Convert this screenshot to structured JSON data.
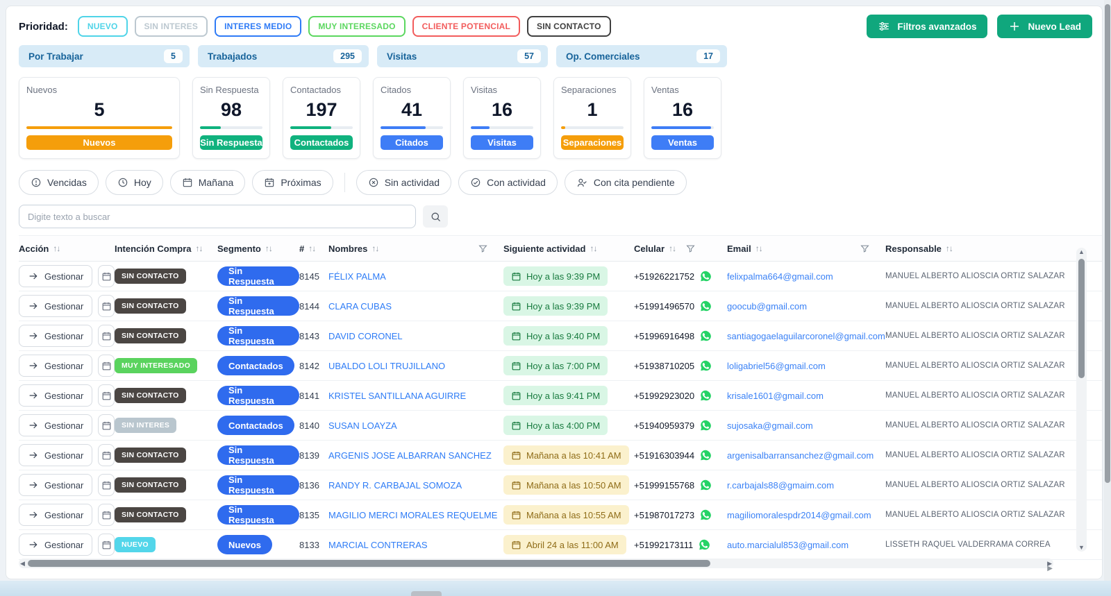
{
  "priority": {
    "label": "Prioridad:",
    "badges": [
      {
        "label": "NUEVO",
        "color": "#4fd4e8"
      },
      {
        "label": "SIN INTERES",
        "color": "#bcc8d0"
      },
      {
        "label": "INTERES MEDIO",
        "color": "#2f7bf6"
      },
      {
        "label": "MUY INTERESADO",
        "color": "#5bd75f"
      },
      {
        "label": "CLIENTE POTENCIAL",
        "color": "#f25c5c"
      },
      {
        "label": "SIN CONTACTO",
        "color": "#3f3f3f"
      }
    ]
  },
  "toolbar": {
    "filters_label": "Filtros avanzados",
    "new_lead_label": "Nuevo Lead",
    "accent_color": "#10a77d"
  },
  "tabs": [
    {
      "label": "Por Trabajar",
      "count": "5"
    },
    {
      "label": "Trabajados",
      "count": "295"
    },
    {
      "label": "Visitas",
      "count": "57"
    },
    {
      "label": "Op. Comerciales",
      "count": "17"
    }
  ],
  "cards": [
    {
      "title": "Nuevos",
      "value": "5",
      "button": "Nuevos",
      "color": "orange",
      "progress": 100,
      "wide": true
    },
    {
      "title": "Sin Respuesta",
      "value": "98",
      "button": "Sin Respuesta",
      "color": "green",
      "progress": 33
    },
    {
      "title": "Contactados",
      "value": "197",
      "button": "Contactados",
      "color": "green",
      "progress": 66
    },
    {
      "title": "Citados",
      "value": "41",
      "button": "Citados",
      "color": "blue",
      "progress": 72
    },
    {
      "title": "Visitas",
      "value": "16",
      "button": "Visitas",
      "color": "blue",
      "progress": 30
    },
    {
      "title": "Separaciones",
      "value": "1",
      "button": "Separaciones",
      "color": "orange",
      "progress": 7
    },
    {
      "title": "Ventas",
      "value": "16",
      "button": "Ventas",
      "color": "blue",
      "progress": 95
    }
  ],
  "chips": [
    {
      "label": "Vencidas",
      "icon": "alert-circle-icon"
    },
    {
      "label": "Hoy",
      "icon": "clock-icon"
    },
    {
      "label": "Mañana",
      "icon": "calendar-icon"
    },
    {
      "label": "Próximas",
      "icon": "calendar-plus-icon"
    },
    {
      "label": "Sin actividad",
      "icon": "x-circle-icon"
    },
    {
      "label": "Con actividad",
      "icon": "check-circle-icon"
    },
    {
      "label": "Con cita pendiente",
      "icon": "user-check-icon"
    }
  ],
  "search": {
    "placeholder": "Digite texto a buscar"
  },
  "table": {
    "action_label": "Gestionar",
    "columns": [
      "Acción",
      "Intención Compra",
      "Segmento",
      "#",
      "Nombres",
      "Siguiente actividad",
      "Celular",
      "Email",
      "Responsable"
    ],
    "intent_colors": {
      "dark": "#4b4643",
      "green": "#5ad35e",
      "gray": "#b9c6ce",
      "cyan": "#53d6ea"
    },
    "rows": [
      {
        "id": "8145",
        "intent": {
          "label": "SIN CONTACTO",
          "color": "dark"
        },
        "segment": "Sin Respuesta",
        "name": "FÉLIX PALMA",
        "activity": {
          "label": "Hoy a las 9:39 PM",
          "tone": "green"
        },
        "phone": "+51926221752",
        "email": "felixpalma664@gmail.com",
        "owner": "MANUEL ALBERTO ALIOSCIA ORTIZ SALAZAR"
      },
      {
        "id": "8144",
        "intent": {
          "label": "SIN CONTACTO",
          "color": "dark"
        },
        "segment": "Sin Respuesta",
        "name": "CLARA CUBAS",
        "activity": {
          "label": "Hoy a las 9:39 PM",
          "tone": "green"
        },
        "phone": "+51991496570",
        "email": "goocub@gmail.com",
        "owner": "MANUEL ALBERTO ALIOSCIA ORTIZ SALAZAR"
      },
      {
        "id": "8143",
        "intent": {
          "label": "SIN CONTACTO",
          "color": "dark"
        },
        "segment": "Sin Respuesta",
        "name": "DAVID CORONEL",
        "activity": {
          "label": "Hoy a las 9:40 PM",
          "tone": "green"
        },
        "phone": "+51996916498",
        "email": "santiagogaelaguilarcoronel@gmail.com",
        "owner": "MANUEL ALBERTO ALIOSCIA ORTIZ SALAZAR"
      },
      {
        "id": "8142",
        "intent": {
          "label": "MUY INTERESADO",
          "color": "green"
        },
        "segment": "Contactados",
        "name": "UBALDO LOLI TRUJILLANO",
        "activity": {
          "label": "Hoy a las 7:00 PM",
          "tone": "green"
        },
        "phone": "+51938710205",
        "email": "loligabriel56@gmail.com",
        "owner": "MANUEL ALBERTO ALIOSCIA ORTIZ SALAZAR"
      },
      {
        "id": "8141",
        "intent": {
          "label": "SIN CONTACTO",
          "color": "dark"
        },
        "segment": "Sin Respuesta",
        "name": "KRISTEL SANTILLANA AGUIRRE",
        "activity": {
          "label": "Hoy a las 9:41 PM",
          "tone": "green"
        },
        "phone": "+51992923020",
        "email": "krisale1601@gmail.com",
        "owner": "MANUEL ALBERTO ALIOSCIA ORTIZ SALAZAR"
      },
      {
        "id": "8140",
        "intent": {
          "label": "SIN INTERES",
          "color": "gray"
        },
        "segment": "Contactados",
        "name": "SUSAN LOAYZA",
        "activity": {
          "label": "Hoy a las 4:00 PM",
          "tone": "green"
        },
        "phone": "+51940959379",
        "email": "sujosaka@gmail.com",
        "owner": "MANUEL ALBERTO ALIOSCIA ORTIZ SALAZAR"
      },
      {
        "id": "8139",
        "intent": {
          "label": "SIN CONTACTO",
          "color": "dark"
        },
        "segment": "Sin Respuesta",
        "name": "ARGENIS JOSE ALBARRAN SANCHEZ",
        "activity": {
          "label": "Mañana a las 10:41 AM",
          "tone": "yellow"
        },
        "phone": "+51916303944",
        "email": "argenisalbarransanchez@gmail.com",
        "owner": "MANUEL ALBERTO ALIOSCIA ORTIZ SALAZAR"
      },
      {
        "id": "8136",
        "intent": {
          "label": "SIN CONTACTO",
          "color": "dark"
        },
        "segment": "Sin Respuesta",
        "name": "RANDY R. CARBAJAL SOMOZA",
        "activity": {
          "label": "Mañana a las 10:50 AM",
          "tone": "yellow"
        },
        "phone": "+51999155768",
        "email": "r.carbajals88@gmaim.com",
        "owner": "MANUEL ALBERTO ALIOSCIA ORTIZ SALAZAR"
      },
      {
        "id": "8135",
        "intent": {
          "label": "SIN CONTACTO",
          "color": "dark"
        },
        "segment": "Sin Respuesta",
        "name": "MAGILIO MERCI MORALES REQUELME",
        "activity": {
          "label": "Mañana a las 10:55 AM",
          "tone": "yellow"
        },
        "phone": "+51987017273",
        "email": "magiliomoralespdr2014@gmail.com",
        "owner": "MANUEL ALBERTO ALIOSCIA ORTIZ SALAZAR"
      },
      {
        "id": "8133",
        "intent": {
          "label": "NUEVO",
          "color": "cyan"
        },
        "segment": "Nuevos",
        "name": "MARCIAL CONTRERAS",
        "activity": {
          "label": "Abril 24 a las 11:00 AM",
          "tone": "yellow"
        },
        "phone": "+51992173111",
        "email": "auto.marcialul853@gmail.com",
        "owner": "LISSETH RAQUEL VALDERRAMA CORREA"
      }
    ]
  }
}
